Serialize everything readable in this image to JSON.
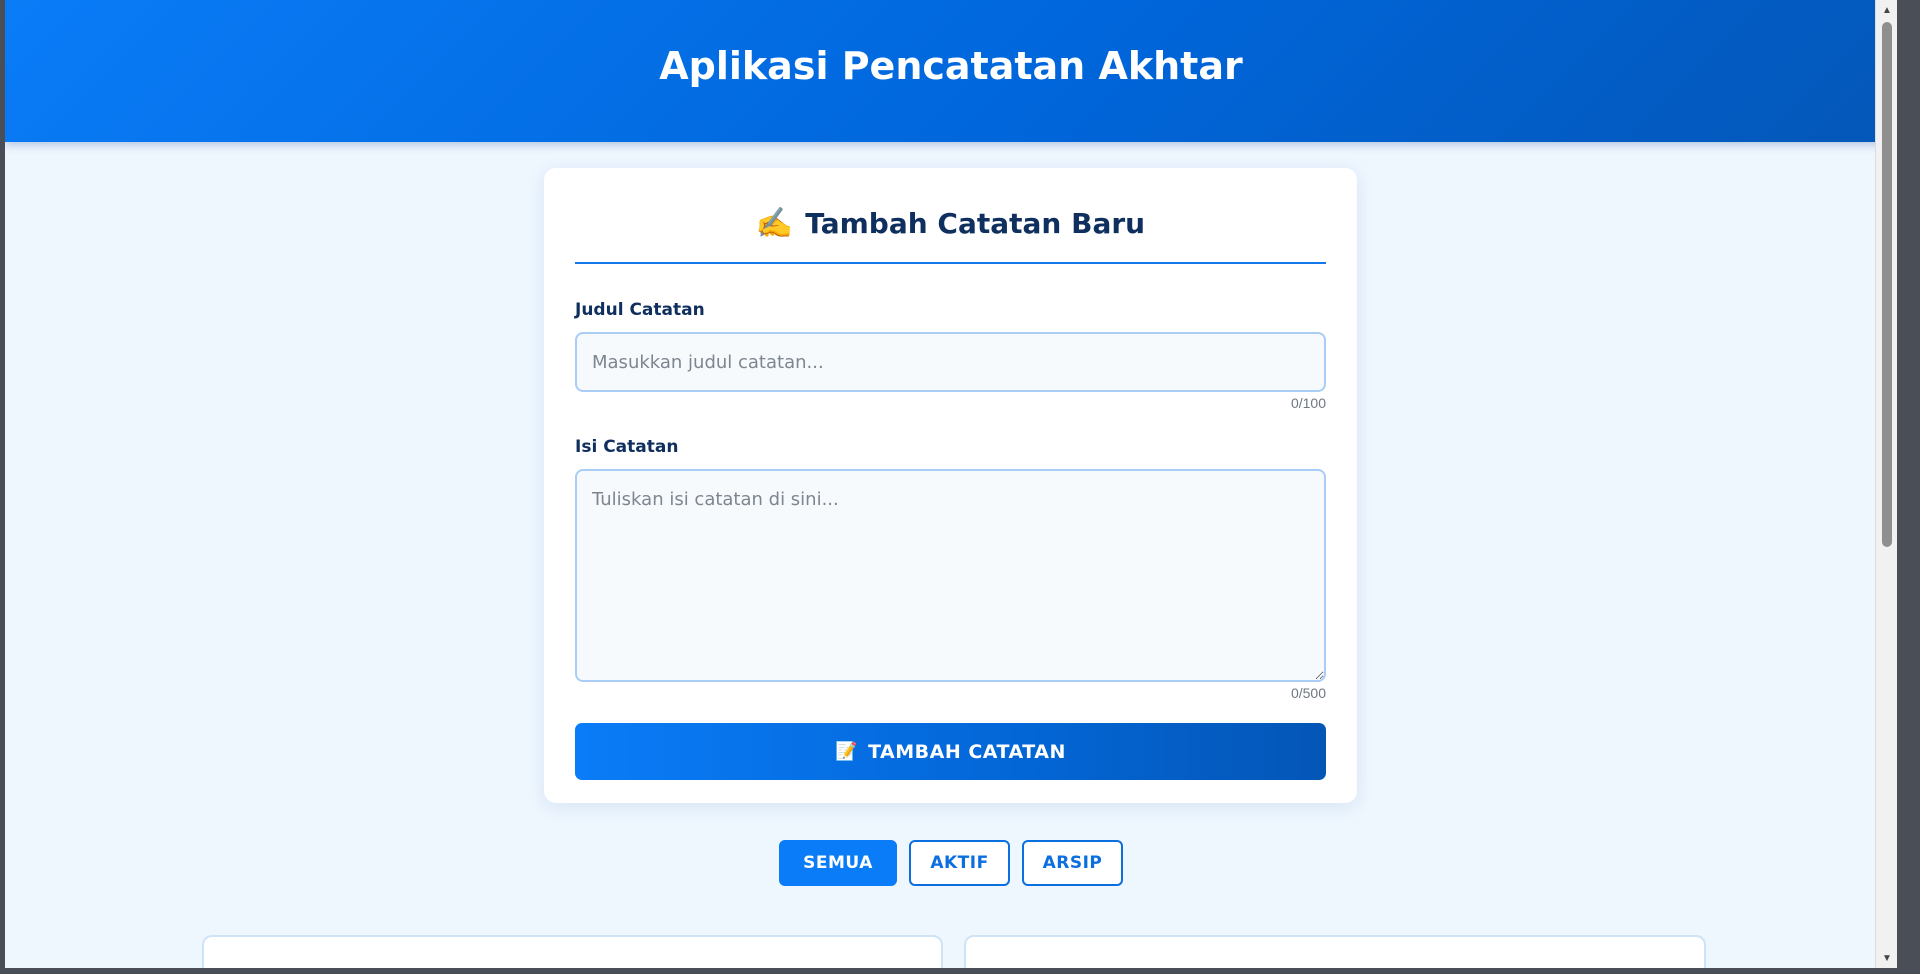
{
  "header": {
    "title": "Aplikasi Pencatatan Akhtar"
  },
  "form": {
    "heading_icon": "pencil-writing-icon",
    "heading_emoji": "✍️",
    "heading": "Tambah Catatan Baru",
    "title_label": "Judul Catatan",
    "title_placeholder": "Masukkan judul catatan...",
    "title_value": "",
    "title_counter": "0/100",
    "body_label": "Isi Catatan",
    "body_placeholder": "Tuliskan isi catatan di sini...",
    "body_value": "",
    "body_counter": "0/500",
    "submit_icon": "memo-icon",
    "submit_emoji": "📝",
    "submit_label": "TAMBAH CATATAN"
  },
  "filters": {
    "all_label": "SEMUA",
    "active_label": "AKTIF",
    "archive_label": "ARSIP",
    "selected": "SEMUA"
  },
  "colors": {
    "primary": "#0a7cf7",
    "heading_text": "#0f2f5e",
    "background": "#eef6fe"
  }
}
